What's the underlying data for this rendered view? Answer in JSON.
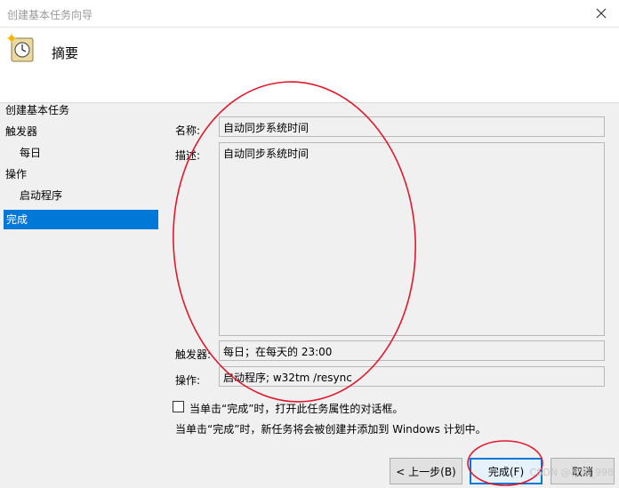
{
  "window": {
    "title": "创建基本任务向导"
  },
  "header": {
    "title": "摘要"
  },
  "sidebar": {
    "items": [
      {
        "label": "创建基本任务"
      },
      {
        "label": "触发器"
      },
      {
        "label": "每日"
      },
      {
        "label": "操作"
      },
      {
        "label": "启动程序"
      },
      {
        "label": "完成"
      }
    ]
  },
  "form": {
    "name_label": "名称:",
    "name_value": "自动同步系统时间",
    "desc_label": "描述:",
    "desc_value": "自动同步系统时间",
    "trigger_label": "触发器:",
    "trigger_value": "每日；在每天的 23:00",
    "action_label": "操作:",
    "action_value": "启动程序; w32tm /resync"
  },
  "checkbox": {
    "label": "当单击“完成”时，打开此任务属性的对话框。",
    "checked": false
  },
  "info_text": "当单击“完成”时，新任务将会被创建并添加到 Windows 计划中。",
  "buttons": {
    "back": "< 上一步(B)",
    "finish": "完成(F)",
    "cancel": "取消"
  },
  "watermark": "CSDN @极客_998",
  "colors": {
    "accent": "#0078d7",
    "annotation": "#e0182d"
  }
}
